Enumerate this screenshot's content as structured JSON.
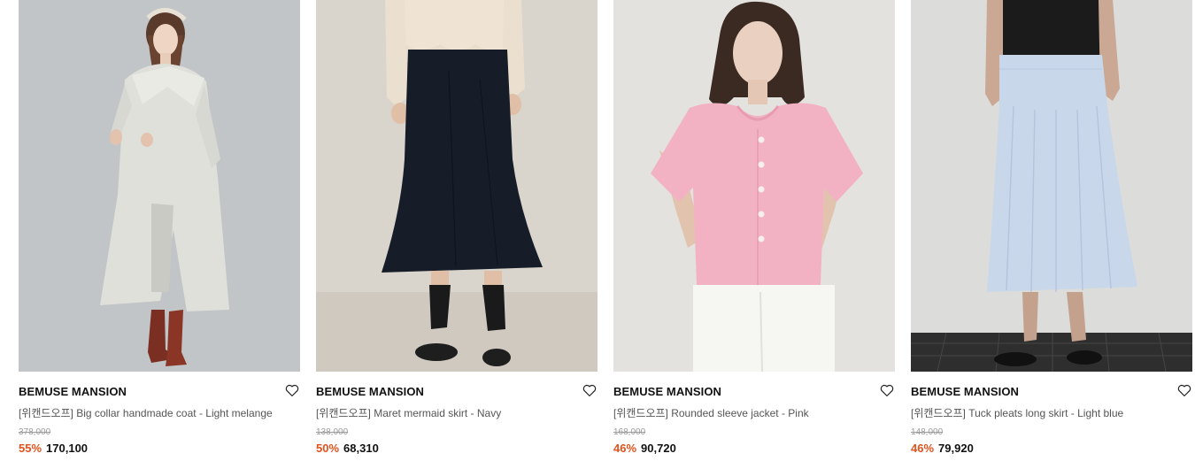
{
  "colors": {
    "discount": "#e3511c",
    "brand_text": "#111111",
    "name_text": "#555555",
    "original_price": "#9a9a9a"
  },
  "products": [
    {
      "brand": "BEMUSE MANSION",
      "name": "[위캔드오프] Big collar handmade coat - Light melange",
      "original_price": "378,000",
      "discount": "55%",
      "price": "170,100",
      "wishlist_icon": "heart-outline-icon"
    },
    {
      "brand": "BEMUSE MANSION",
      "name": "[위캔드오프] Maret mermaid skirt - Navy",
      "original_price": "138,000",
      "discount": "50%",
      "price": "68,310",
      "wishlist_icon": "heart-outline-icon"
    },
    {
      "brand": "BEMUSE MANSION",
      "name": "[위캔드오프] Rounded sleeve jacket - Pink",
      "original_price": "168,000",
      "discount": "46%",
      "price": "90,720",
      "wishlist_icon": "heart-outline-icon"
    },
    {
      "brand": "BEMUSE MANSION",
      "name": "[위캔드오프] Tuck pleats long skirt - Light blue",
      "original_price": "148,000",
      "discount": "46%",
      "price": "79,920",
      "wishlist_icon": "heart-outline-icon"
    }
  ]
}
